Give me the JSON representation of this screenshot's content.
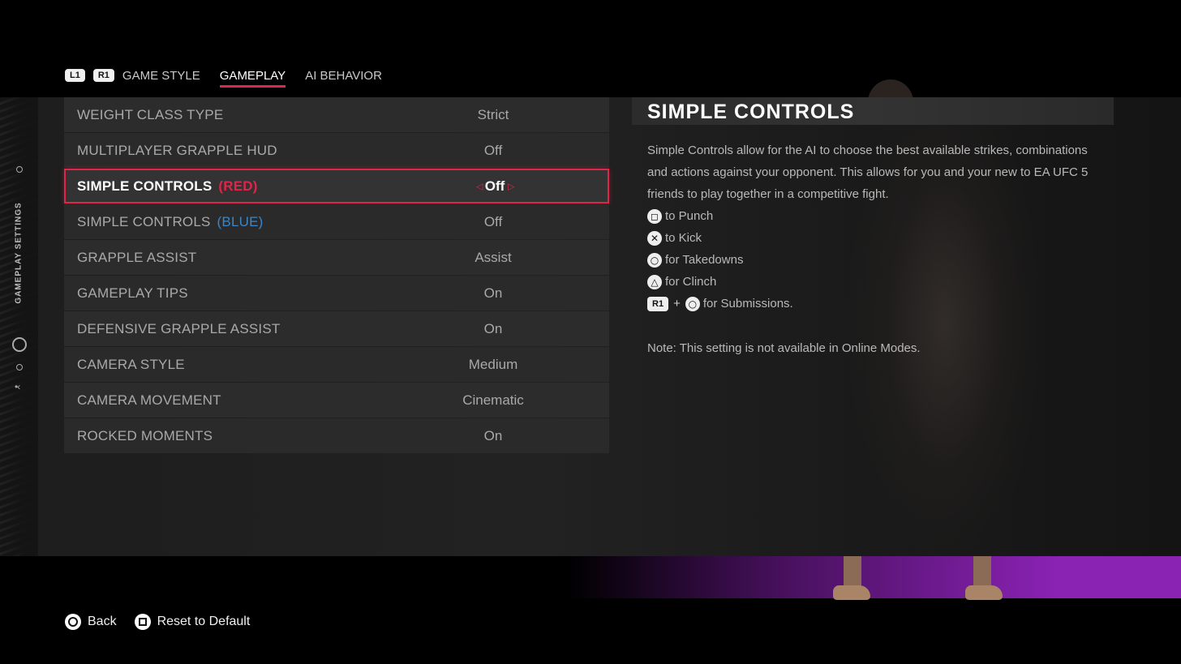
{
  "tabbar": {
    "l1": "L1",
    "r1": "R1",
    "tabs": [
      {
        "label": "GAME STYLE"
      },
      {
        "label": "GAMEPLAY"
      },
      {
        "label": "AI BEHAVIOR"
      }
    ]
  },
  "sidebar": {
    "title": "GAMEPLAY SETTINGS"
  },
  "settings": [
    {
      "label": "WEIGHT CLASS TYPE",
      "value": "Strict"
    },
    {
      "label": "MULTIPLAYER GRAPPLE HUD",
      "value": "Off"
    },
    {
      "label": "SIMPLE CONTROLS",
      "tag": "(RED)",
      "value": "Off"
    },
    {
      "label": "SIMPLE CONTROLS",
      "tag": "(BLUE)",
      "value": "Off"
    },
    {
      "label": "GRAPPLE ASSIST",
      "value": "Assist"
    },
    {
      "label": "GAMEPLAY TIPS",
      "value": "On"
    },
    {
      "label": "DEFENSIVE GRAPPLE ASSIST",
      "value": "On"
    },
    {
      "label": "CAMERA STYLE",
      "value": "Medium"
    },
    {
      "label": "CAMERA MOVEMENT",
      "value": "Cinematic"
    },
    {
      "label": "ROCKED MOMENTS",
      "value": "On"
    }
  ],
  "info": {
    "title": "SIMPLE CONTROLS",
    "description": "Simple Controls allow for the AI to choose the best available strikes, combinations and actions against your opponent. This allows for you and your new to EA UFC 5 friends to play together in a competitive fight.",
    "controls": [
      {
        "icon": "square",
        "text": "to Punch"
      },
      {
        "icon": "cross",
        "text": "to Kick"
      },
      {
        "icon": "circle",
        "text": "for Takedowns"
      },
      {
        "icon": "triangle",
        "text": "for Clinch"
      }
    ],
    "combo": {
      "button": "R1",
      "plus": "+",
      "text": "for Submissions."
    },
    "note": "Note: This setting is not available in Online Modes."
  },
  "footer": {
    "back": "Back",
    "reset": "Reset to Default"
  },
  "colors": {
    "accent": "#e0254b",
    "blue": "#3a86c8",
    "stage_purple": "#8a22b4"
  }
}
